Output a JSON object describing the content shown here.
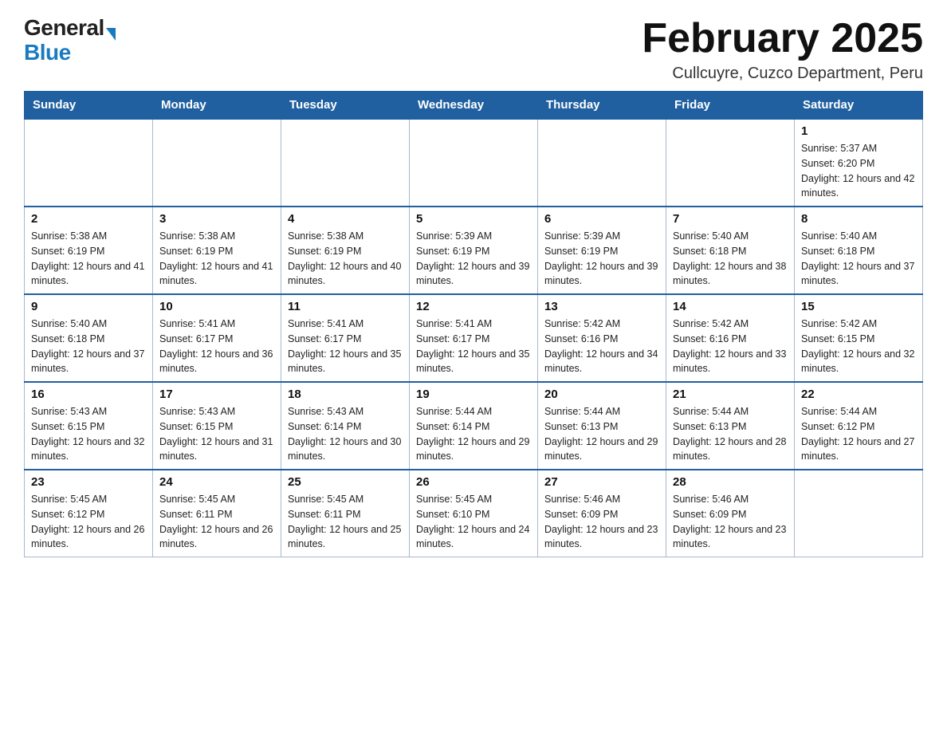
{
  "header": {
    "logo_general": "General",
    "logo_blue": "Blue",
    "title": "February 2025",
    "location": "Cullcuyre, Cuzco Department, Peru"
  },
  "days_of_week": [
    "Sunday",
    "Monday",
    "Tuesday",
    "Wednesday",
    "Thursday",
    "Friday",
    "Saturday"
  ],
  "weeks": [
    [
      {
        "day": "",
        "info": ""
      },
      {
        "day": "",
        "info": ""
      },
      {
        "day": "",
        "info": ""
      },
      {
        "day": "",
        "info": ""
      },
      {
        "day": "",
        "info": ""
      },
      {
        "day": "",
        "info": ""
      },
      {
        "day": "1",
        "info": "Sunrise: 5:37 AM\nSunset: 6:20 PM\nDaylight: 12 hours and 42 minutes."
      }
    ],
    [
      {
        "day": "2",
        "info": "Sunrise: 5:38 AM\nSunset: 6:19 PM\nDaylight: 12 hours and 41 minutes."
      },
      {
        "day": "3",
        "info": "Sunrise: 5:38 AM\nSunset: 6:19 PM\nDaylight: 12 hours and 41 minutes."
      },
      {
        "day": "4",
        "info": "Sunrise: 5:38 AM\nSunset: 6:19 PM\nDaylight: 12 hours and 40 minutes."
      },
      {
        "day": "5",
        "info": "Sunrise: 5:39 AM\nSunset: 6:19 PM\nDaylight: 12 hours and 39 minutes."
      },
      {
        "day": "6",
        "info": "Sunrise: 5:39 AM\nSunset: 6:19 PM\nDaylight: 12 hours and 39 minutes."
      },
      {
        "day": "7",
        "info": "Sunrise: 5:40 AM\nSunset: 6:18 PM\nDaylight: 12 hours and 38 minutes."
      },
      {
        "day": "8",
        "info": "Sunrise: 5:40 AM\nSunset: 6:18 PM\nDaylight: 12 hours and 37 minutes."
      }
    ],
    [
      {
        "day": "9",
        "info": "Sunrise: 5:40 AM\nSunset: 6:18 PM\nDaylight: 12 hours and 37 minutes."
      },
      {
        "day": "10",
        "info": "Sunrise: 5:41 AM\nSunset: 6:17 PM\nDaylight: 12 hours and 36 minutes."
      },
      {
        "day": "11",
        "info": "Sunrise: 5:41 AM\nSunset: 6:17 PM\nDaylight: 12 hours and 35 minutes."
      },
      {
        "day": "12",
        "info": "Sunrise: 5:41 AM\nSunset: 6:17 PM\nDaylight: 12 hours and 35 minutes."
      },
      {
        "day": "13",
        "info": "Sunrise: 5:42 AM\nSunset: 6:16 PM\nDaylight: 12 hours and 34 minutes."
      },
      {
        "day": "14",
        "info": "Sunrise: 5:42 AM\nSunset: 6:16 PM\nDaylight: 12 hours and 33 minutes."
      },
      {
        "day": "15",
        "info": "Sunrise: 5:42 AM\nSunset: 6:15 PM\nDaylight: 12 hours and 32 minutes."
      }
    ],
    [
      {
        "day": "16",
        "info": "Sunrise: 5:43 AM\nSunset: 6:15 PM\nDaylight: 12 hours and 32 minutes."
      },
      {
        "day": "17",
        "info": "Sunrise: 5:43 AM\nSunset: 6:15 PM\nDaylight: 12 hours and 31 minutes."
      },
      {
        "day": "18",
        "info": "Sunrise: 5:43 AM\nSunset: 6:14 PM\nDaylight: 12 hours and 30 minutes."
      },
      {
        "day": "19",
        "info": "Sunrise: 5:44 AM\nSunset: 6:14 PM\nDaylight: 12 hours and 29 minutes."
      },
      {
        "day": "20",
        "info": "Sunrise: 5:44 AM\nSunset: 6:13 PM\nDaylight: 12 hours and 29 minutes."
      },
      {
        "day": "21",
        "info": "Sunrise: 5:44 AM\nSunset: 6:13 PM\nDaylight: 12 hours and 28 minutes."
      },
      {
        "day": "22",
        "info": "Sunrise: 5:44 AM\nSunset: 6:12 PM\nDaylight: 12 hours and 27 minutes."
      }
    ],
    [
      {
        "day": "23",
        "info": "Sunrise: 5:45 AM\nSunset: 6:12 PM\nDaylight: 12 hours and 26 minutes."
      },
      {
        "day": "24",
        "info": "Sunrise: 5:45 AM\nSunset: 6:11 PM\nDaylight: 12 hours and 26 minutes."
      },
      {
        "day": "25",
        "info": "Sunrise: 5:45 AM\nSunset: 6:11 PM\nDaylight: 12 hours and 25 minutes."
      },
      {
        "day": "26",
        "info": "Sunrise: 5:45 AM\nSunset: 6:10 PM\nDaylight: 12 hours and 24 minutes."
      },
      {
        "day": "27",
        "info": "Sunrise: 5:46 AM\nSunset: 6:09 PM\nDaylight: 12 hours and 23 minutes."
      },
      {
        "day": "28",
        "info": "Sunrise: 5:46 AM\nSunset: 6:09 PM\nDaylight: 12 hours and 23 minutes."
      },
      {
        "day": "",
        "info": ""
      }
    ]
  ]
}
